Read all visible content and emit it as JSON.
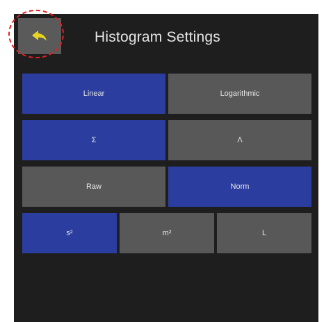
{
  "header": {
    "title": "Histogram Settings",
    "back_icon": "back-arrow-icon",
    "back_icon_color": "#e6d420"
  },
  "colors": {
    "active": "#2b3ea0",
    "inactive": "#585858",
    "background": "#1e1e1e",
    "highlight": "#e32020"
  },
  "options": {
    "scale": [
      {
        "label": "Linear",
        "selected": true
      },
      {
        "label": "Logarithmic",
        "selected": false
      }
    ],
    "mode": [
      {
        "label": "Σ",
        "selected": true
      },
      {
        "label": "Λ",
        "selected": false
      }
    ],
    "normalization": [
      {
        "label": "Raw",
        "selected": false
      },
      {
        "label": "Norm",
        "selected": true
      }
    ],
    "unit": [
      {
        "label": "s²",
        "selected": true
      },
      {
        "label": "m²",
        "selected": false
      },
      {
        "label": "L",
        "selected": false
      }
    ]
  }
}
